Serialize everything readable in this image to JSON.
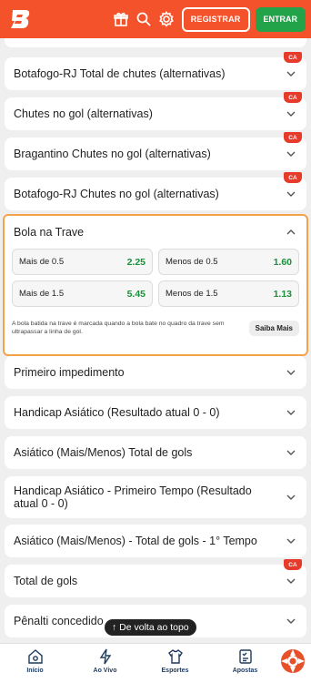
{
  "header": {
    "registrar_label": "REGISTRAR",
    "entrar_label": "ENTRAR",
    "brand_color": "#f4522a"
  },
  "markets": {
    "botafogo_total_chutes": "Botafogo-RJ Total de chutes (alternativas)",
    "chutes_no_gol": "Chutes no gol (alternativas)",
    "bragantino_chutes": "Bragantino Chutes no gol (alternativas)",
    "botafogo_chutes": "Botafogo-RJ Chutes no gol (alternativas)",
    "primeiro_impedimento": "Primeiro impedimento",
    "handicap_asiatico": "Handicap Asiático (Resultado atual 0 - 0)",
    "asiatico_total": "Asiático (Mais/Menos) Total de gols",
    "handicap_primeiro_tempo": "Handicap Asiático - Primeiro Tempo (Resultado atual 0 - 0)",
    "asiatico_primeiro_tempo": "Asiático (Mais/Menos) - Total de gols - 1° Tempo",
    "total_de_gols": "Total de gols",
    "penalti": "Pênalti concedido"
  },
  "badge": "CA",
  "bola_na_trave": {
    "title": "Bola na Trave",
    "odds": [
      {
        "label": "Mais de 0.5",
        "value": "2.25"
      },
      {
        "label": "Menos de 0.5",
        "value": "1.60"
      },
      {
        "label": "Mais de 1.5",
        "value": "5.45"
      },
      {
        "label": "Menos de 1.5",
        "value": "1.13"
      }
    ],
    "info": "A bola batida na trave é marcada quando a bola bate no quadro da trave sem ultrapassar a linha de gol.",
    "saiba_mais": "Saiba Mais"
  },
  "back_to_top": "↑ De volta ao topo",
  "nav": {
    "inicio": "Início",
    "ao_vivo": "Ao Vivo",
    "esportes": "Esportes",
    "apostas": "Apostas"
  },
  "colors": {
    "odd_green": "#1c8f3a",
    "highlight_border": "#f5a34a",
    "badge_red": "#e63b2a",
    "entrar_green": "#22a34a"
  }
}
